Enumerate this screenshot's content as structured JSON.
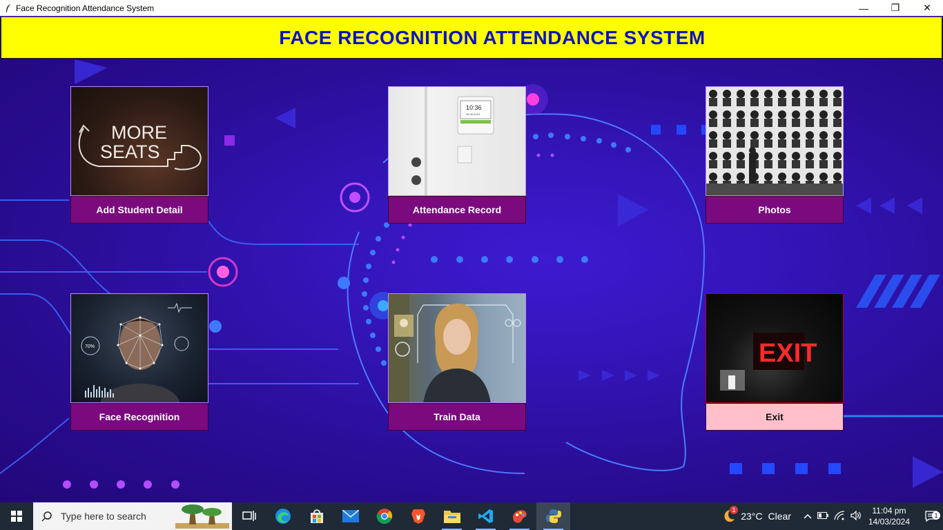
{
  "window": {
    "title": "Face Recognition Attendance System",
    "controls": {
      "minimize": "—",
      "maximize": "❐",
      "close": "✕"
    }
  },
  "header": {
    "title": "FACE RECOGNITION ATTENDANCE SYSTEM"
  },
  "tiles": [
    {
      "label": "Add Student Detail",
      "image": "more-seats-sign-image",
      "image_text": [
        "MORE",
        "SEATS"
      ]
    },
    {
      "label": "Attendance Record",
      "image": "time-clock-device-image",
      "image_text": [
        "10:36",
        "28.06.2019"
      ]
    },
    {
      "label": "Photos",
      "image": "photo-wall-image"
    },
    {
      "label": "Face Recognition",
      "image": "face-scan-image",
      "image_text": [
        "70%"
      ]
    },
    {
      "label": "Train Data",
      "image": "woman-hud-image"
    },
    {
      "label": "Exit",
      "image": "exit-sign-image",
      "image_text": [
        "EXIT"
      ]
    }
  ],
  "taskbar": {
    "search_placeholder": "Type here to search",
    "apps": [
      "task-view-icon",
      "edge-icon",
      "store-icon",
      "mail-icon",
      "chrome-icon",
      "brave-icon",
      "file-explorer-icon",
      "vscode-icon",
      "paint-icon",
      "python-icon"
    ],
    "weather": {
      "temperature": "23°C",
      "condition": "Clear",
      "badge": "1"
    },
    "clock": {
      "time": "11:04 pm",
      "date": "14/03/2024"
    },
    "notifications_count": "1"
  },
  "colors": {
    "header_bg": "#ffff00",
    "header_text": "#0b12c8",
    "tile_button": "#7a0a7e",
    "exit_button": "#ffc0cb",
    "background": "#2a0e98"
  }
}
